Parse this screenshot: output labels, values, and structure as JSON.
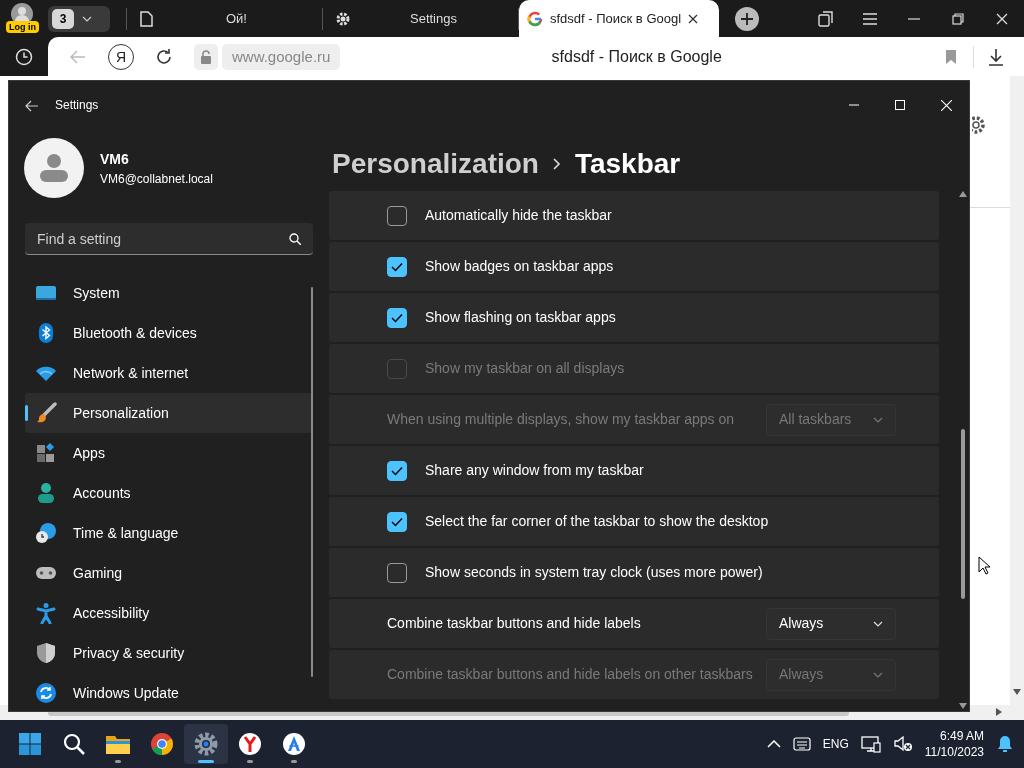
{
  "browser": {
    "profile_badge": "Log in",
    "tab_count": "3",
    "tabs": [
      {
        "title": "Ой!",
        "kind": "page",
        "selected": false
      },
      {
        "title": "Settings",
        "kind": "settings",
        "selected": false
      },
      {
        "title": "sfdsdf - Поиск в Googl",
        "kind": "google",
        "selected": true
      }
    ],
    "yandex_button": "Я",
    "address": "www.google.ru",
    "page_title": "sfdsdf - Поиск в Google"
  },
  "settings_window": {
    "title": "Settings",
    "user": {
      "name": "VM6",
      "email": "VM6@collabnet.local"
    },
    "search": {
      "placeholder": "Find a setting"
    },
    "nav": [
      {
        "label": "System",
        "kind": "system",
        "selected": false
      },
      {
        "label": "Bluetooth & devices",
        "kind": "bluetooth",
        "selected": false
      },
      {
        "label": "Network & internet",
        "kind": "network",
        "selected": false
      },
      {
        "label": "Personalization",
        "kind": "personalization",
        "selected": true
      },
      {
        "label": "Apps",
        "kind": "apps",
        "selected": false
      },
      {
        "label": "Accounts",
        "kind": "accounts",
        "selected": false
      },
      {
        "label": "Time & language",
        "kind": "time",
        "selected": false
      },
      {
        "label": "Gaming",
        "kind": "gaming",
        "selected": false
      },
      {
        "label": "Accessibility",
        "kind": "accessibility",
        "selected": false
      },
      {
        "label": "Privacy & security",
        "kind": "privacy",
        "selected": false
      },
      {
        "label": "Windows Update",
        "kind": "update",
        "selected": false
      }
    ],
    "breadcrumb": {
      "parent": "Personalization",
      "current": "Taskbar"
    },
    "options": [
      {
        "kind": "checkbox",
        "label": "Automatically hide the taskbar",
        "checked": false,
        "disabled": false
      },
      {
        "kind": "checkbox",
        "label": "Show badges on taskbar apps",
        "checked": true,
        "disabled": false
      },
      {
        "kind": "checkbox",
        "label": "Show flashing on taskbar apps",
        "checked": true,
        "disabled": false
      },
      {
        "kind": "checkbox",
        "label": "Show my taskbar on all displays",
        "checked": false,
        "disabled": true
      },
      {
        "kind": "dropdown",
        "label": "When using multiple displays, show my taskbar apps on",
        "value": "All taskbars",
        "disabled": true
      },
      {
        "kind": "checkbox",
        "label": "Share any window from my taskbar",
        "checked": true,
        "disabled": false
      },
      {
        "kind": "checkbox",
        "label": "Select the far corner of the taskbar to show the desktop",
        "checked": true,
        "disabled": false
      },
      {
        "kind": "checkbox",
        "label": "Show seconds in system tray clock (uses more power)",
        "checked": false,
        "disabled": false
      },
      {
        "kind": "dropdown",
        "label": "Combine taskbar buttons and hide labels",
        "value": "Always",
        "disabled": false
      },
      {
        "kind": "dropdown",
        "label": "Combine taskbar buttons and hide labels on other taskbars",
        "value": "Always",
        "disabled": true
      }
    ]
  },
  "taskbar": {
    "apps": [
      {
        "kind": "start",
        "running": false,
        "selected": false
      },
      {
        "kind": "search",
        "running": false,
        "selected": false
      },
      {
        "kind": "explorer",
        "running": true,
        "selected": false
      },
      {
        "kind": "chrome",
        "running": false,
        "selected": false
      },
      {
        "kind": "settings",
        "running": true,
        "selected": true
      },
      {
        "kind": "yandex",
        "running": true,
        "selected": false
      },
      {
        "kind": "appinstaller",
        "running": true,
        "selected": false
      }
    ],
    "language": "ENG",
    "time": "6:49 AM",
    "date": "11/10/2023"
  }
}
